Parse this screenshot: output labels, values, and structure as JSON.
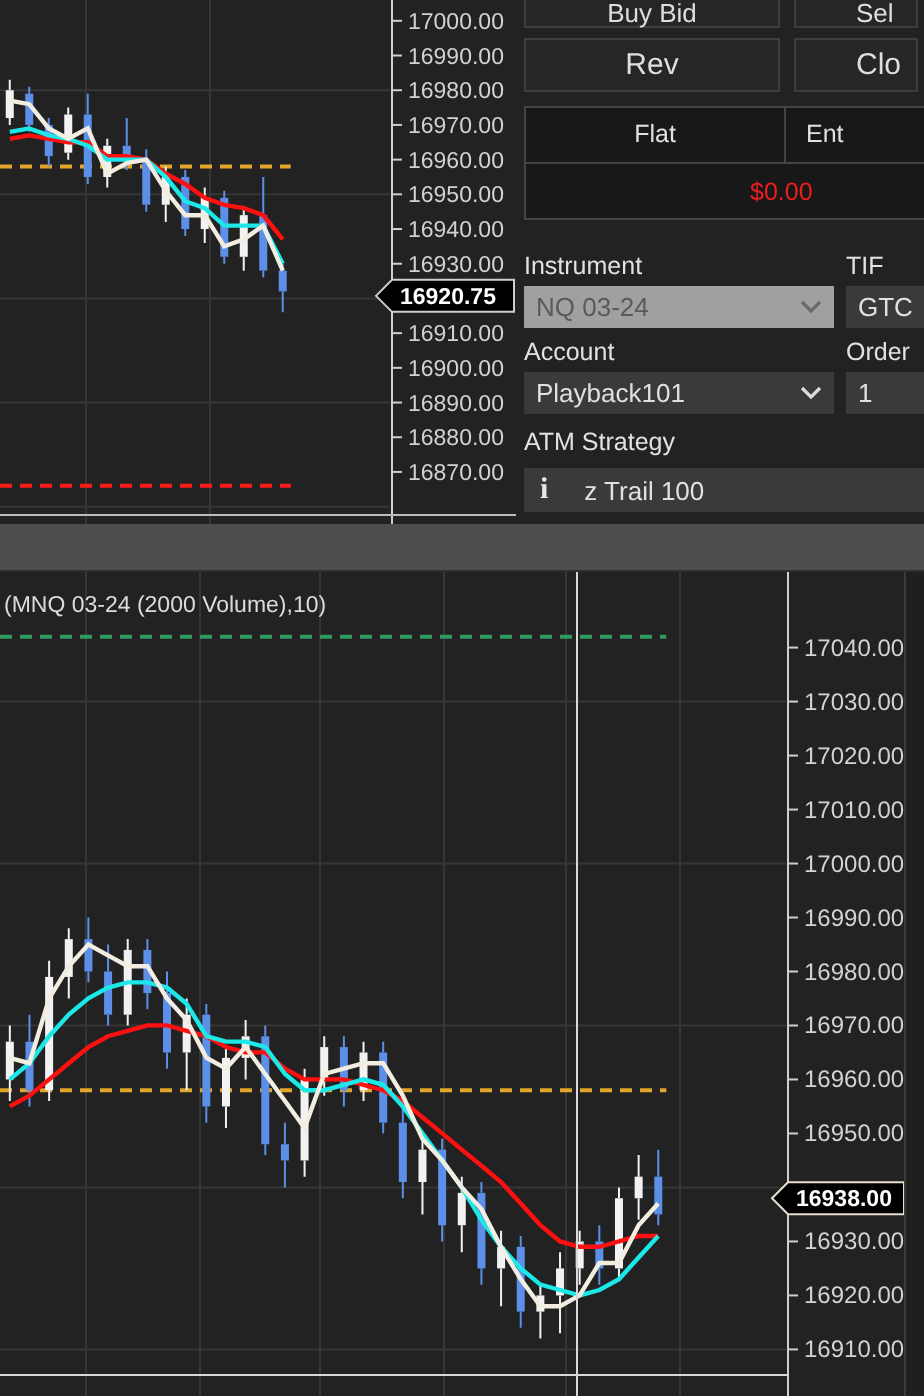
{
  "top_chart": {
    "last_price": "16920.75",
    "chart_data": {
      "type": "candlestick",
      "grid": true,
      "ylim": [
        16855,
        17006
      ],
      "yticks": [
        {
          "value": 17000,
          "label": "17000.00"
        },
        {
          "value": 16990,
          "label": "16990.00"
        },
        {
          "value": 16980,
          "label": "16980.00"
        },
        {
          "value": 16970,
          "label": "16970.00"
        },
        {
          "value": 16960,
          "label": "16960.00"
        },
        {
          "value": 16950,
          "label": "16950.00"
        },
        {
          "value": 16940,
          "label": "16940.00"
        },
        {
          "value": 16930,
          "label": "16930.00"
        },
        {
          "value": 16910,
          "label": "16910.00"
        },
        {
          "value": 16900,
          "label": "16900.00"
        },
        {
          "value": 16890,
          "label": "16890.00"
        },
        {
          "value": 16880,
          "label": "16880.00"
        },
        {
          "value": 16870,
          "label": "16870.00"
        }
      ],
      "ohlc": [
        [
          16972,
          16983,
          16970,
          16980
        ],
        [
          16979,
          16981,
          16968,
          16970
        ],
        [
          16970,
          16972,
          16958,
          16961
        ],
        [
          16962,
          16975,
          16960,
          16973
        ],
        [
          16973,
          16979,
          16953,
          16955
        ],
        [
          16955,
          16966,
          16952,
          16964
        ],
        [
          16964,
          16972,
          16957,
          16960
        ],
        [
          16960,
          16963,
          16945,
          16947
        ],
        [
          16947,
          16958,
          16942,
          16955
        ],
        [
          16955,
          16957,
          16938,
          16940
        ],
        [
          16940,
          16952,
          16936,
          16949
        ],
        [
          16949,
          16951,
          16930,
          16932
        ],
        [
          16932,
          16946,
          16928,
          16944
        ],
        [
          16944,
          16955,
          16926,
          16928
        ],
        [
          16928,
          16930,
          16916,
          16922
        ],
        null,
        null,
        null,
        null,
        null
      ],
      "series": [
        {
          "type": "line",
          "color": "#ff1010",
          "values": [
            16966,
            16967,
            16966,
            16965,
            16965,
            16961,
            16961,
            16960,
            16956,
            16953,
            16949,
            16947,
            16946,
            16944,
            16937,
            null,
            null,
            null,
            null,
            null
          ]
        },
        {
          "type": "line",
          "color": "#1de8e8",
          "values": [
            16968,
            16969,
            16967,
            16966,
            16964,
            16960,
            16960,
            16960,
            16955,
            16948,
            16946,
            16941,
            16941,
            16941,
            16930,
            null,
            null,
            null,
            null,
            null
          ]
        },
        {
          "type": "line",
          "color": "#f2ede0",
          "values": [
            16977,
            16976,
            16969,
            16966,
            16969,
            16956,
            16959,
            16960,
            16951,
            16944,
            16944,
            16935,
            16937,
            16941,
            16928,
            null,
            null,
            null,
            null,
            null
          ]
        }
      ],
      "ref_lines": [
        {
          "axis": "y",
          "value": 16958,
          "color": "#e0a52a"
        },
        {
          "axis": "y",
          "value": 16866,
          "color": "#ff1a1a"
        }
      ]
    }
  },
  "order_panel": {
    "buttons": [
      {
        "label": "Buy Bid"
      },
      {
        "label": "Sel"
      },
      {
        "label": "Rev"
      },
      {
        "label": "Clo"
      }
    ],
    "position": {
      "headers": [
        "Flat",
        "Ent"
      ],
      "pnl": "$0.00"
    },
    "fields": [
      {
        "label": "Instrument",
        "value": "NQ 03-24",
        "kind": "dropdown",
        "disabled": true
      },
      {
        "label": "TIF",
        "value": "GTC",
        "kind": "text",
        "disabled": false
      },
      {
        "label": "Account",
        "value": "Playback101",
        "kind": "dropdown",
        "disabled": false
      },
      {
        "label": "Order",
        "value": "1",
        "kind": "text",
        "disabled": false
      }
    ],
    "atm": {
      "label": "ATM Strategy",
      "icon": "i",
      "value": "z Trail 100"
    }
  },
  "bottom_chart": {
    "title": "(MNQ 03-24 (2000 Volume),10)",
    "last_price": "16938.00",
    "chart_data": {
      "type": "candlestick",
      "grid": true,
      "ylim": [
        16901,
        17054
      ],
      "yticks": [
        {
          "value": 17040,
          "label": "17040.00"
        },
        {
          "value": 17030,
          "label": "17030.00"
        },
        {
          "value": 17020,
          "label": "17020.00"
        },
        {
          "value": 17010,
          "label": "17010.00"
        },
        {
          "value": 17000,
          "label": "17000.00"
        },
        {
          "value": 16990,
          "label": "16990.00"
        },
        {
          "value": 16980,
          "label": "16980.00"
        },
        {
          "value": 16970,
          "label": "16970.00"
        },
        {
          "value": 16960,
          "label": "16960.00"
        },
        {
          "value": 16950,
          "label": "16950.00"
        },
        {
          "value": 16930,
          "label": "16930.00"
        },
        {
          "value": 16920,
          "label": "16920.00"
        },
        {
          "value": 16910,
          "label": "16910.00"
        }
      ],
      "ohlc": [
        [
          16960,
          16970,
          16956,
          16967
        ],
        [
          16967,
          16972,
          16955,
          16958
        ],
        [
          16958,
          16982,
          16956,
          16979
        ],
        [
          16979,
          16988,
          16975,
          16986
        ],
        [
          16986,
          16990,
          16978,
          16980
        ],
        [
          16980,
          16985,
          16970,
          16972
        ],
        [
          16972,
          16986,
          16970,
          16984
        ],
        [
          16984,
          16986,
          16973,
          16976
        ],
        [
          16976,
          16980,
          16962,
          16965
        ],
        [
          16965,
          16975,
          16958,
          16972
        ],
        [
          16972,
          16974,
          16952,
          16955
        ],
        [
          16955,
          16966,
          16951,
          16964
        ],
        [
          16964,
          16971,
          16960,
          16968
        ],
        [
          16968,
          16970,
          16946,
          16948
        ],
        [
          16948,
          16952,
          16940,
          16945
        ],
        [
          16945,
          16962,
          16942,
          16960
        ],
        [
          16960,
          16968,
          16957,
          16966
        ],
        [
          16966,
          16968,
          16955,
          16958
        ],
        [
          16958,
          16967,
          16956,
          16965
        ],
        [
          16965,
          16967,
          16950,
          16952
        ],
        [
          16952,
          16955,
          16938,
          16941
        ],
        [
          16941,
          16950,
          16935,
          16947
        ],
        [
          16947,
          16949,
          16930,
          16933
        ],
        [
          16933,
          16942,
          16928,
          16939
        ],
        [
          16939,
          16941,
          16922,
          16925
        ],
        [
          16925,
          16932,
          16918,
          16929
        ],
        [
          16929,
          16931,
          16914,
          16917
        ],
        [
          16917,
          16922,
          16912,
          16920
        ],
        [
          16920,
          16928,
          16913,
          16925
        ],
        [
          16925,
          16932,
          16922,
          16930
        ],
        [
          16930,
          16933,
          16922,
          16925
        ],
        [
          16925,
          16940,
          16923,
          16938
        ],
        [
          16938,
          16946,
          16934,
          16942
        ],
        [
          16942,
          16947,
          16933,
          16935
        ],
        null,
        null,
        null,
        null,
        null,
        null
      ],
      "series": [
        {
          "type": "line",
          "color": "#ff1010",
          "values": [
            16955,
            16957,
            16960,
            16963,
            16966,
            16968,
            16969,
            16970,
            16970,
            16969,
            16968,
            16966,
            16965,
            16965,
            16962,
            16960,
            16960,
            16960,
            16959,
            16958,
            16956,
            16953,
            16950,
            16947,
            16944,
            16941,
            16937,
            16933,
            16930,
            16929,
            16929,
            16930,
            16931,
            16931,
            null,
            null,
            null,
            null,
            null,
            null
          ]
        },
        {
          "type": "line",
          "color": "#1de8e8",
          "values": [
            16960,
            16963,
            16968,
            16972,
            16975,
            16977,
            16978,
            16978,
            16977,
            16974,
            16968,
            16967,
            16967,
            16966,
            16961,
            16958,
            16958,
            16959,
            16960,
            16959,
            16955,
            16950,
            16945,
            16940,
            16934,
            16929,
            16925,
            16922,
            16921,
            16920,
            16921,
            16923,
            16927,
            16931,
            null,
            null,
            null,
            null,
            null,
            null
          ]
        },
        {
          "type": "line",
          "color": "#f2ede0",
          "values": [
            16964,
            16963,
            16975,
            16981,
            16985,
            16983,
            16981,
            16981,
            16975,
            16971,
            16964,
            16962,
            16966,
            16961,
            16956,
            16951,
            16961,
            16962,
            16963,
            16963,
            16957,
            16949,
            16945,
            16940,
            16936,
            16929,
            16923,
            16918,
            16918,
            16920,
            16926,
            16926,
            16933,
            16937,
            null,
            null,
            null,
            null,
            null,
            null
          ]
        }
      ],
      "ref_lines": [
        {
          "axis": "y",
          "value": 16958,
          "color": "#e0a52a"
        },
        {
          "axis": "y",
          "value": 17042,
          "color": "#2e9a5e"
        }
      ]
    }
  }
}
